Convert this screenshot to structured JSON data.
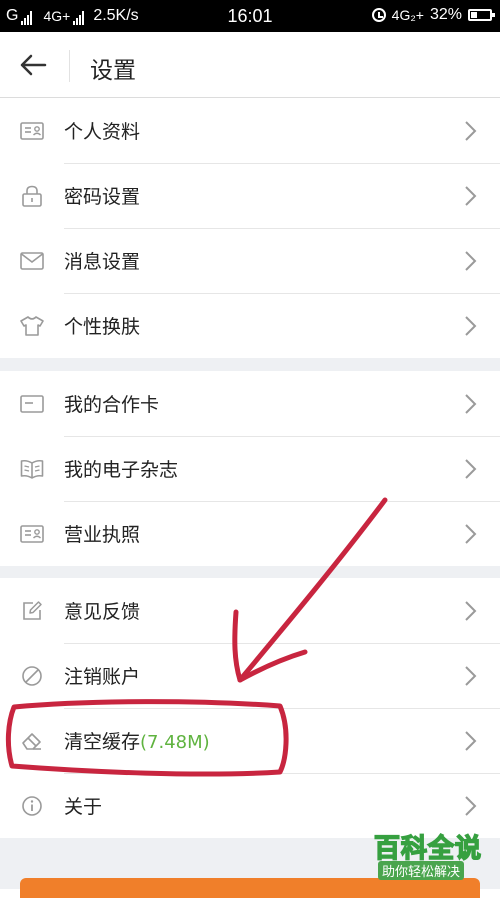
{
  "status_bar": {
    "carrier": "G",
    "network": "4G+",
    "speed": "2.5K/s",
    "time": "16:01",
    "right_network": "4G₂+",
    "battery": "32%",
    "battery_level": 0.32
  },
  "header": {
    "title": "设置",
    "back_icon": "arrow-left-icon"
  },
  "sections": [
    {
      "items": [
        {
          "label": "个人资料",
          "icon": "id-card-icon"
        },
        {
          "label": "密码设置",
          "icon": "lock-icon"
        },
        {
          "label": "消息设置",
          "icon": "envelope-icon"
        },
        {
          "label": "个性换肤",
          "icon": "tshirt-icon"
        }
      ]
    },
    {
      "items": [
        {
          "label": "我的合作卡",
          "icon": "card-icon"
        },
        {
          "label": "我的电子杂志",
          "icon": "book-icon"
        },
        {
          "label": "营业执照",
          "icon": "license-icon"
        }
      ]
    },
    {
      "items": [
        {
          "label": "意见反馈",
          "icon": "edit-icon"
        },
        {
          "label": "注销账户",
          "icon": "ban-icon"
        },
        {
          "label": "清空缓存",
          "sub": "(7.48M)",
          "icon": "eraser-icon"
        },
        {
          "label": "关于",
          "icon": "info-icon"
        }
      ]
    }
  ],
  "watermark": {
    "title": "百科全说",
    "subtitle": "助你轻松解决"
  },
  "colors": {
    "accent_green": "#5fb33f",
    "annotation_red": "#c8253f",
    "section_gap": "#eef0f3",
    "bottom_button": "#f07f2a"
  }
}
